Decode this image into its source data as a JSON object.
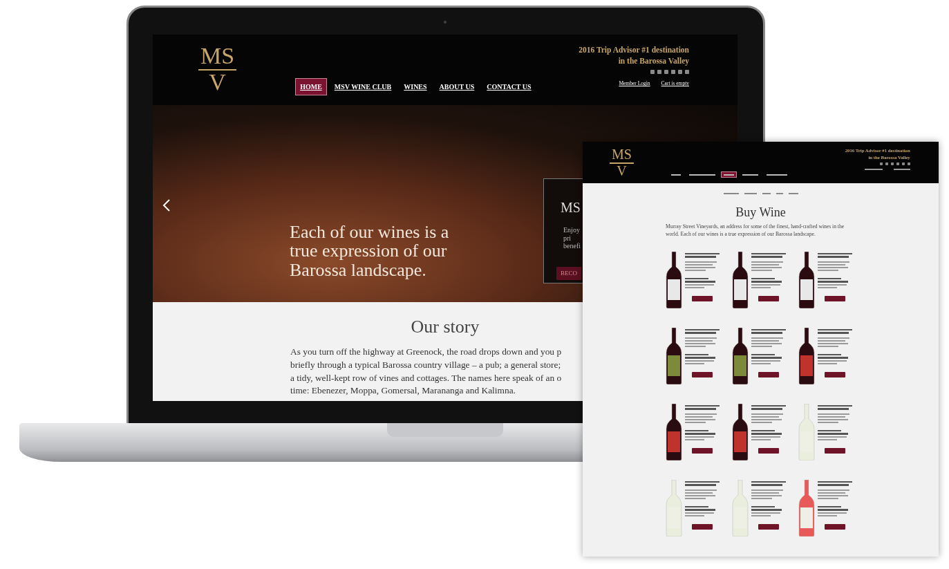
{
  "laptop_page": {
    "logo": {
      "top": "MS",
      "bottom": "V"
    },
    "nav": [
      {
        "label": "HOME",
        "selected": true
      },
      {
        "label": "MSV WINE CLUB",
        "selected": false
      },
      {
        "label": "WINES",
        "selected": false
      },
      {
        "label": "ABOUT US",
        "selected": false
      },
      {
        "label": "CONTACT US",
        "selected": false
      }
    ],
    "tagline": [
      "2016 Trip Advisor #1 destination",
      "in the Barossa Valley"
    ],
    "account_links": [
      "Member Login",
      "Cart is empty"
    ],
    "hero": {
      "headline": [
        "Each of our wines is a",
        "true expression of our",
        "Barossa landscape."
      ],
      "promo": {
        "title": "MS",
        "lines": [
          "Enjoy",
          "pri",
          "benefi"
        ],
        "button": "BECO"
      }
    },
    "story": {
      "title": "Our story",
      "lines": [
        "As you turn off the highway at Greenock, the road drops down and you p",
        "briefly through a typical Barossa country village – a pub; a general store;",
        "a tidy, well-kept row of vines and cottages. The names here speak of an o",
        "time: Ebenezer, Moppa, Gomersal, Marananga and Kalimna."
      ]
    }
  },
  "wine_page": {
    "logo": {
      "top": "MS",
      "bottom": "V"
    },
    "nav": [
      {
        "selected": false
      },
      {
        "selected": false
      },
      {
        "selected": true
      },
      {
        "selected": false
      },
      {
        "selected": false
      }
    ],
    "tagline": [
      "2016 Trip Advisor #1 destination",
      "in the Barossa Valley"
    ],
    "heading": "Buy Wine",
    "intro": "Murray Street Vineyards, an address for some of the finest, hand-crafted wines in the world. Each of our wines is a true expression of our Barossa landscape.",
    "products": [
      {
        "kind": "red",
        "color": "#e8e8e8"
      },
      {
        "kind": "red",
        "color": "#e8e8e8"
      },
      {
        "kind": "red",
        "color": "#e8e8e8"
      },
      {
        "kind": "red",
        "color": "#7d8a3a"
      },
      {
        "kind": "red",
        "color": "#7d8a3a"
      },
      {
        "kind": "red",
        "color": "#c0322c"
      },
      {
        "kind": "red",
        "color": "#c0322c"
      },
      {
        "kind": "red",
        "color": "#c0322c"
      },
      {
        "kind": "white",
        "color": "#eef0e6"
      },
      {
        "kind": "white",
        "color": "#eef0e6"
      },
      {
        "kind": "white",
        "color": "#eef0e6"
      },
      {
        "kind": "rose",
        "color": "#eef0e6"
      }
    ]
  }
}
